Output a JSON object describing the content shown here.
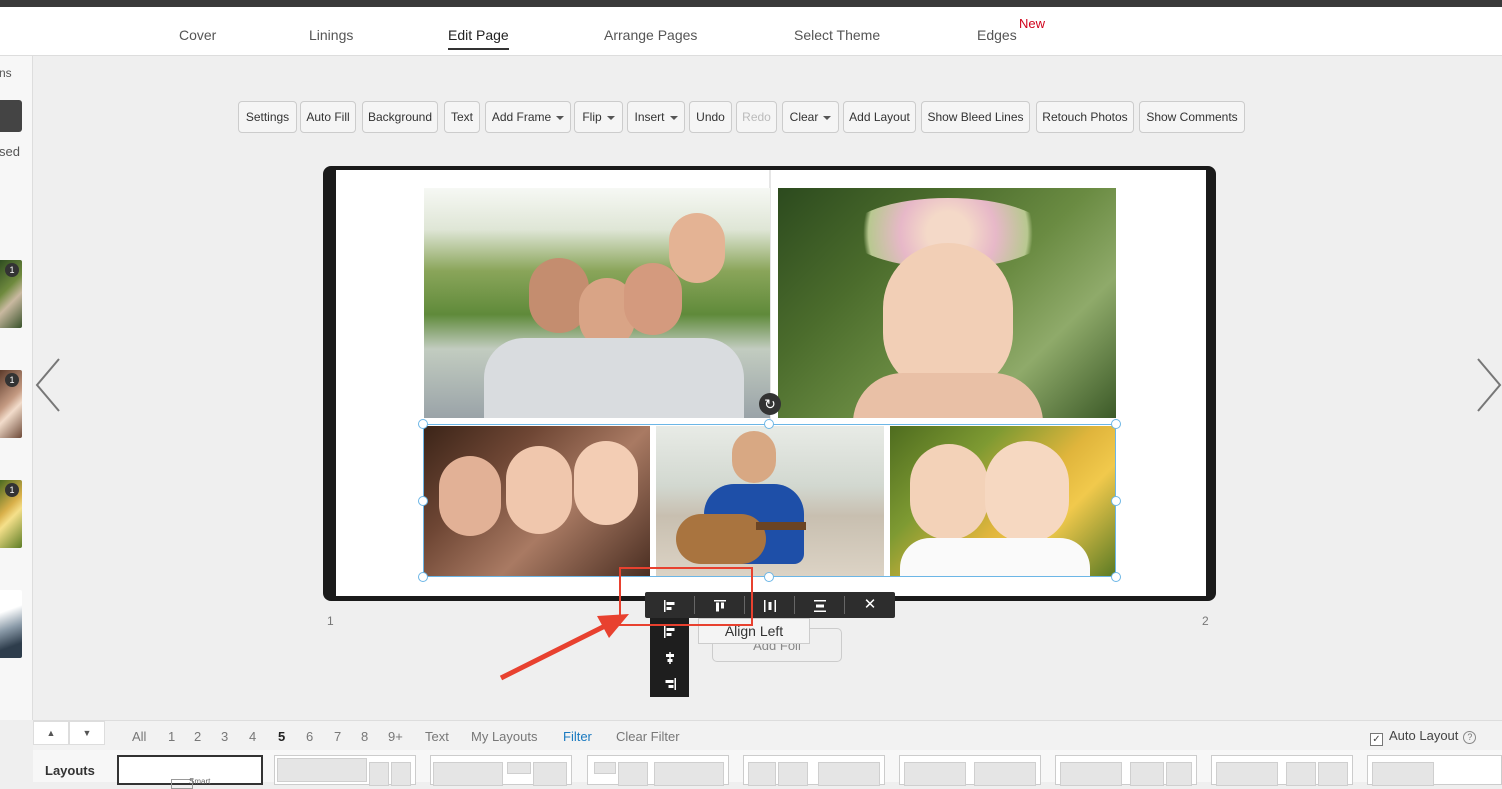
{
  "tabs": [
    {
      "label": "Cover"
    },
    {
      "label": "Linings"
    },
    {
      "label": "Edit Page"
    },
    {
      "label": "Arrange Pages"
    },
    {
      "label": "Select Theme"
    },
    {
      "label": "Edges"
    }
  ],
  "new_badge": "New",
  "left_panel": {
    "text_top": "ns",
    "text_used": "sed",
    "thumb_count": "1"
  },
  "toolbar": {
    "settings": "Settings",
    "auto_fill": "Auto Fill",
    "background": "Background",
    "text": "Text",
    "add_frame": "Add Frame",
    "flip": "Flip",
    "insert": "Insert",
    "undo": "Undo",
    "redo": "Redo",
    "clear": "Clear",
    "add_layout": "Add Layout",
    "show_bleed_lines": "Show Bleed Lines",
    "retouch_photos": "Retouch Photos",
    "show_comments": "Show Comments"
  },
  "page_numbers": {
    "left": "1",
    "right": "2"
  },
  "tooltip": "Align Left",
  "add_foil": "Add Foil",
  "filters": {
    "all": "All",
    "p1": "1",
    "p2": "2",
    "p3": "3",
    "p4": "4",
    "p5": "5",
    "p6": "6",
    "p7": "7",
    "p8": "8",
    "p9": "9+",
    "text": "Text",
    "my_layouts": "My Layouts",
    "filter": "Filter",
    "clear_filter": "Clear Filter"
  },
  "auto_layout": {
    "label": "Auto Layout",
    "checked": true
  },
  "layouts_label": "Layouts",
  "smart_label": "Smart",
  "colors": {
    "accent_blue": "#1a7ac0",
    "new_red": "#d0021b",
    "annotation_red": "#e8412f",
    "selection_blue": "#6cb6e6"
  }
}
